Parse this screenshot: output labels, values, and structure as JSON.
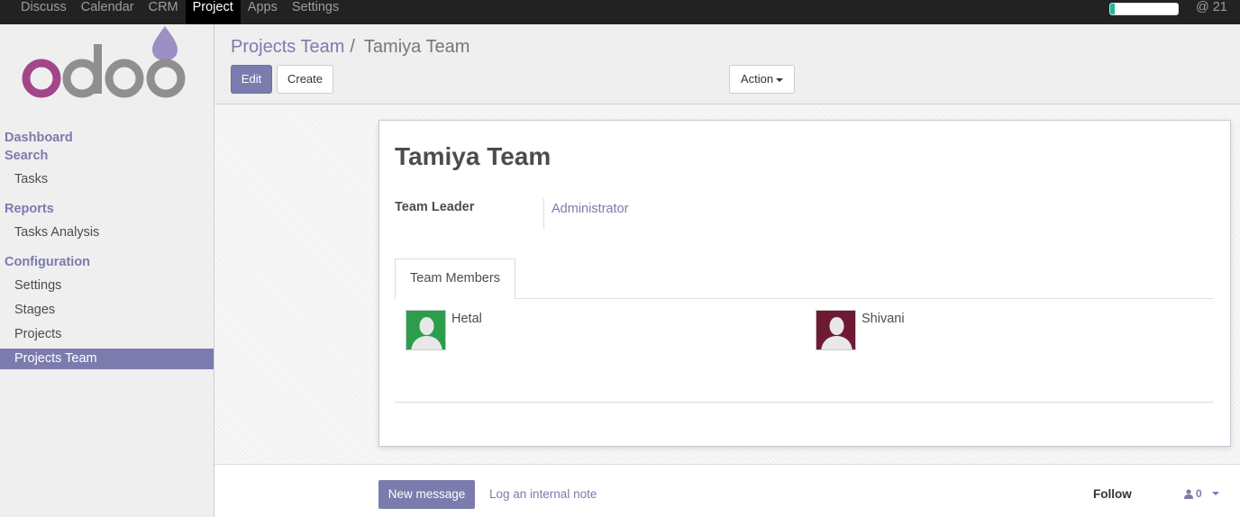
{
  "topbar": {
    "menu": [
      "Discuss",
      "Calendar",
      "CRM",
      "Project",
      "Apps",
      "Settings"
    ],
    "active_index": 3,
    "progress": 0.07,
    "right_text": "@ 21"
  },
  "sidebar": {
    "logo_text": "odoo",
    "sections": [
      {
        "heading": "Dashboard",
        "items": []
      },
      {
        "heading": "Search",
        "items": [
          "Tasks"
        ]
      },
      {
        "heading": "Reports",
        "items": [
          "Tasks Analysis"
        ]
      },
      {
        "heading": "Configuration",
        "items": [
          "Settings",
          "Stages",
          "Projects",
          "Projects Team"
        ]
      }
    ],
    "active_item": "Projects Team"
  },
  "control": {
    "breadcrumb_parent": "Projects Team",
    "breadcrumb_sep": "/",
    "breadcrumb_current": "Tamiya Team",
    "edit_label": "Edit",
    "create_label": "Create",
    "action_label": "Action"
  },
  "form": {
    "title": "Tamiya Team",
    "team_leader_label": "Team Leader",
    "team_leader_value": "Administrator",
    "tab_label": "Team Members",
    "members": [
      {
        "name": "Hetal",
        "color": "#2c9d4a"
      },
      {
        "name": "Shivani",
        "color": "#6e1a33"
      }
    ]
  },
  "chatter": {
    "new_message_label": "New message",
    "log_note_label": "Log an internal note",
    "follow_label": "Follow",
    "followers_count": "0"
  },
  "colors": {
    "accent": "#7c7bad",
    "topbar_bg": "#222222",
    "progress_fill": "#21b799"
  }
}
